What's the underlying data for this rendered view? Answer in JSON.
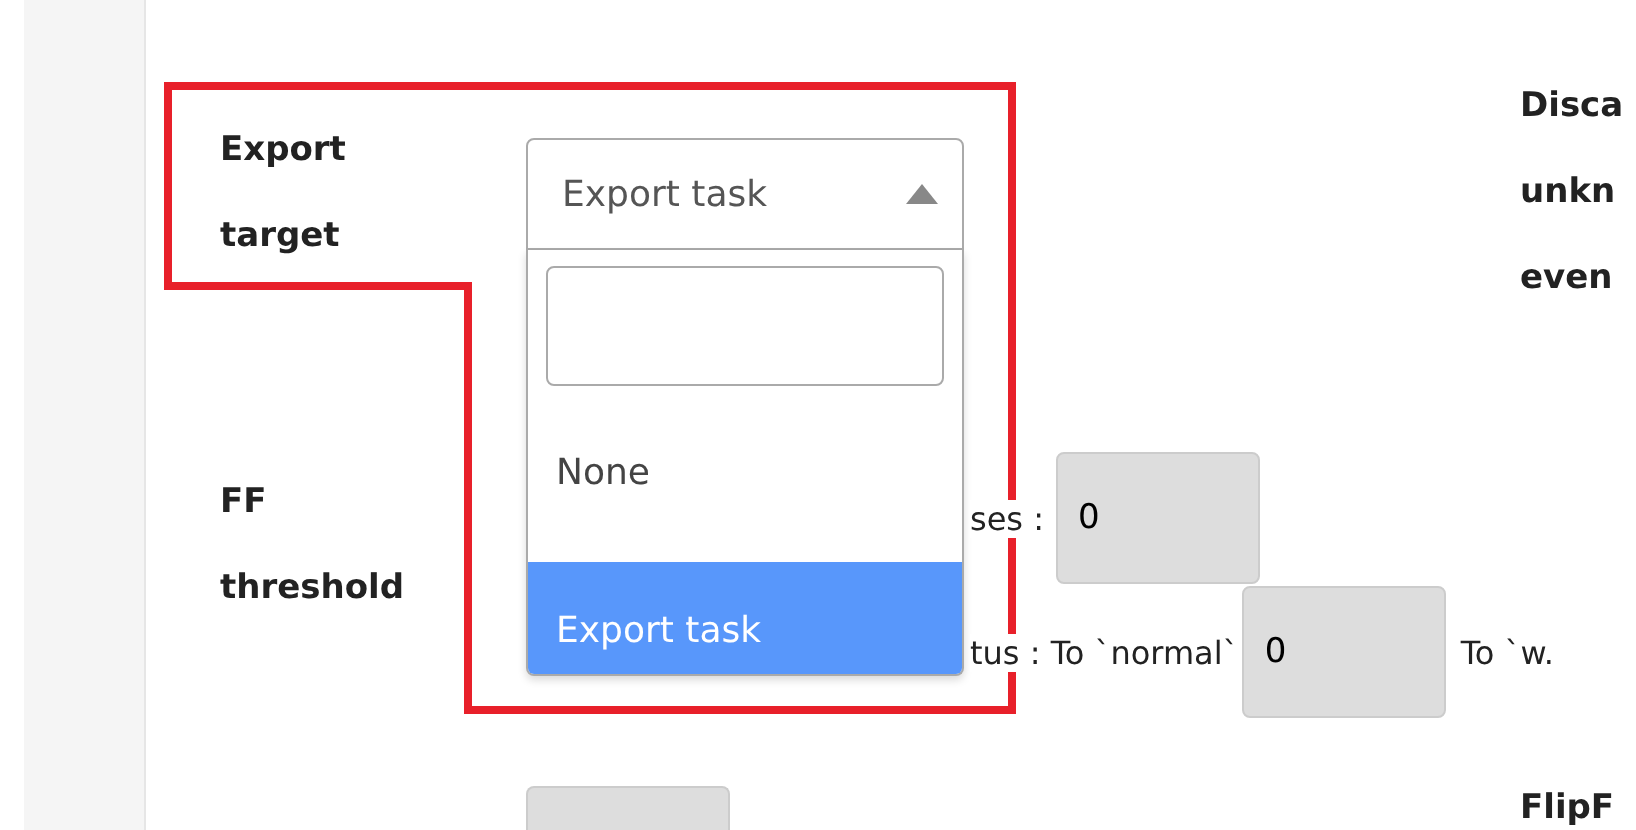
{
  "export_target": {
    "label_lines": [
      "Export",
      "target"
    ],
    "select": {
      "value": "Export task",
      "expanded": true
    },
    "dropdown": {
      "options": [
        {
          "label": "None",
          "selected": false
        },
        {
          "label": "Export task",
          "selected": true
        }
      ]
    }
  },
  "right_label_lines": [
    "Disca",
    "unkn",
    "even"
  ],
  "ff_threshold": {
    "label_lines": [
      "FF",
      "threshold"
    ],
    "row_1": {
      "text": "ses :",
      "input": "0"
    },
    "row_2": {
      "text": "tus : To `normal`",
      "input": "0",
      "after": "To `w."
    }
  },
  "bottom_right_label": "FlipF"
}
